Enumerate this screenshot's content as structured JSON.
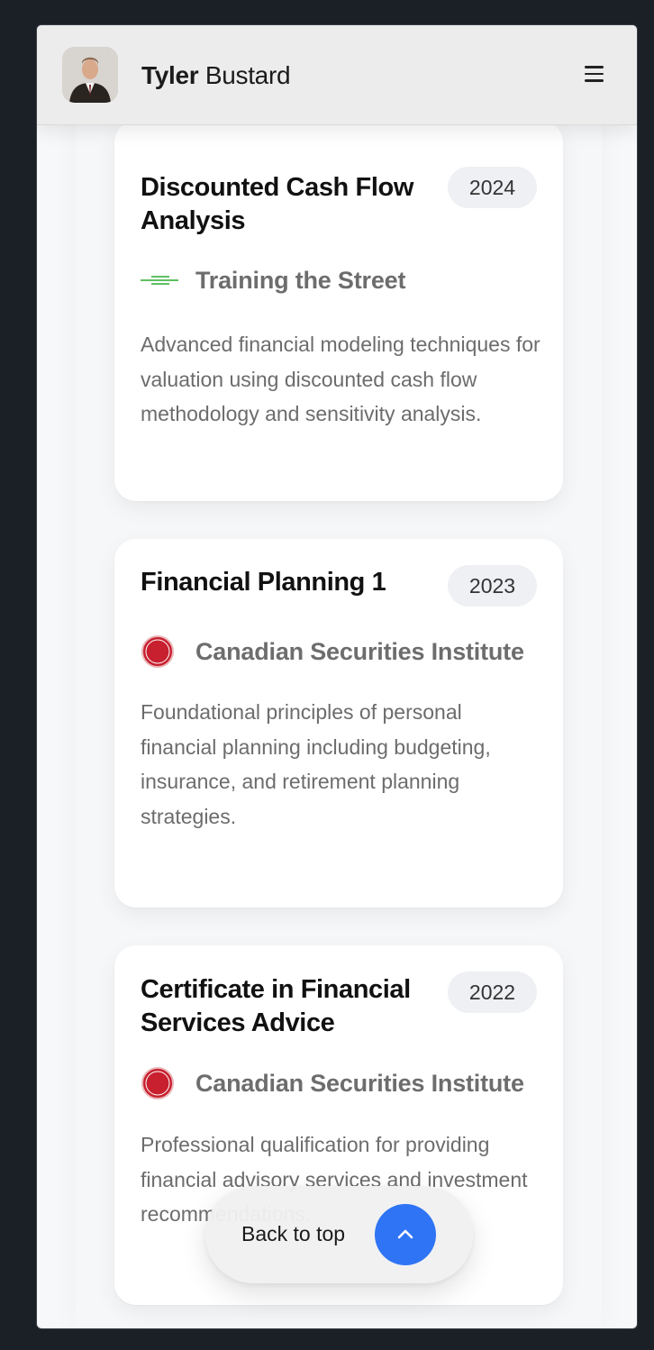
{
  "header": {
    "first_name": "Tyler",
    "last_name": "Bustard",
    "avatar_icon": "profile-photo",
    "menu_icon": "hamburger-icon"
  },
  "certifications": [
    {
      "title": "Discounted Cash Flow Analysis",
      "year": "2024",
      "issuer": "Training the Street",
      "issuer_icon": "training-the-street-logo",
      "description": "Advanced financial modeling techniques for valuation using discounted cash flow methodology and sensitivity analysis."
    },
    {
      "title": "Financial Planning 1",
      "year": "2023",
      "issuer": "Canadian Securities Institute",
      "issuer_icon": "csi-logo",
      "description": "Foundational principles of personal financial planning including budgeting, insurance, and retirement planning strategies."
    },
    {
      "title": "Certificate in Financial Services Advice",
      "year": "2022",
      "issuer": "Canadian Securities Institute",
      "issuer_icon": "csi-logo",
      "description": "Professional qualification for providing financial advisory services and investment recommendations."
    }
  ],
  "back_to_top": {
    "label": "Back to top",
    "icon": "chevron-up-icon"
  },
  "colors": {
    "accent": "#2f74f5",
    "csi_red": "#c8202f",
    "tts_green": "#4caf50"
  }
}
